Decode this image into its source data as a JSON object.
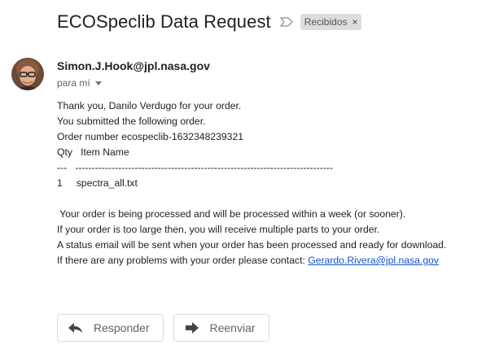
{
  "header": {
    "subject": "ECOSpeclib Data Request",
    "label": "Recibidos",
    "label_remove": "×"
  },
  "sender": {
    "name": "Simon.J.Hook@jpl.nasa.gov",
    "recipient": "para mí",
    "avatar_icon": "person-photo"
  },
  "message": {
    "lines": [
      "Thank you, Danilo Verdugo for your order.",
      "You submitted the following order.",
      "Order number ecospeclib-1632348239321",
      "Qty   Item Name",
      "---   ------------------------------------------------------------------------------",
      "1     spectra_all.txt",
      "",
      " Your order is being processed and will be processed within a week (or sooner).",
      "If your order is too large then, you will receive multiple parts to your order.",
      "A status email will be sent when your order has been processed and ready for download."
    ],
    "contact_prefix": "If there are any problems with your order please contact: ",
    "contact_email": "Gerardo.Rivera@jpl.nasa.gov"
  },
  "actions": {
    "reply_label": "Responder",
    "forward_label": "Reenviar"
  },
  "icons": {
    "importance": "importance-marker-icon",
    "reply": "reply-arrow-icon",
    "forward": "forward-arrow-icon"
  }
}
